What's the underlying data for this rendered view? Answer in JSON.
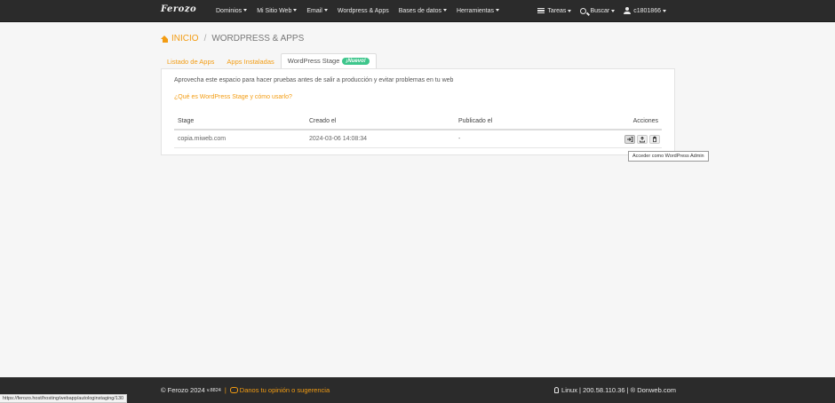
{
  "navbar": {
    "brand": "Ferozo",
    "menu": [
      "Dominios",
      "Mi Sitio Web",
      "Email",
      "Wordpress & Apps",
      "Bases de datos",
      "Herramientas"
    ],
    "tasks": "Tareas",
    "search": "Buscar",
    "user": "c1801866"
  },
  "breadcrumb": {
    "home": "INICIO",
    "separator": "/",
    "current": "WORDPRESS & APPS"
  },
  "tabs": [
    {
      "label": "Listado de Apps"
    },
    {
      "label": "Apps Instaladas"
    },
    {
      "label": "WordPress Stage",
      "badge": "¡Nuevo!"
    }
  ],
  "panel": {
    "intro": "Aprovecha este espacio para hacer pruebas antes de salir a producción y evitar problemas en tu web",
    "help_link": "¿Qué es WordPress Stage y cómo usarlo?",
    "table": {
      "headers": [
        "Stage",
        "Creado el",
        "Publicado el",
        "Acciones"
      ],
      "rows": [
        {
          "stage": "copia.miweb.com",
          "created": "2024-03-06 14:08:34",
          "published": "-"
        }
      ]
    }
  },
  "tooltip": "Acceder como WordPress Admin",
  "footer": {
    "copyright": "© Ferozo 2024",
    "version": "v.8824",
    "pipe": "|",
    "feedback": "Danos tu opinión o sugerencia",
    "server": "Linux | 200.58.110.36 | ® Donweb.com"
  },
  "statusbar": "https://ferozo.host/hosting/webapp/autologinstaging/130"
}
